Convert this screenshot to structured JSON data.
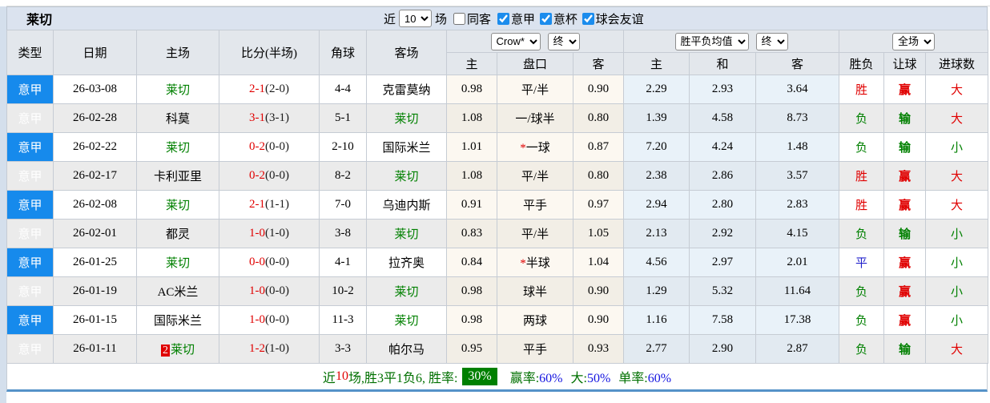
{
  "title": "莱切",
  "controls": {
    "recent_label": "近",
    "matches_value": "10",
    "matches_label": "场",
    "same_away": {
      "label": "同客",
      "checked": false
    },
    "filters": [
      {
        "label": "意甲",
        "checked": true
      },
      {
        "label": "意杯",
        "checked": true
      },
      {
        "label": "球会友谊",
        "checked": true
      }
    ]
  },
  "table": {
    "headers": {
      "type": "类型",
      "date": "日期",
      "home": "主场",
      "score": "比分(半场)",
      "corner": "角球",
      "away": "客场",
      "crow_dropdown": "Crow*",
      "crow_final_dropdown": "终",
      "avg_dropdown": "胜平负均值",
      "avg_final_dropdown": "终",
      "scope_dropdown": "全场",
      "odds_home": "主",
      "odds_handicap": "盘口",
      "odds_away": "客",
      "avg_home": "主",
      "avg_draw": "和",
      "avg_away": "客",
      "result": "胜负",
      "handicap_result": "让球",
      "goals": "进球数"
    },
    "rows": [
      {
        "league": "意甲",
        "date": "26-03-08",
        "home": "莱切",
        "home_focus": true,
        "home_badge": "",
        "score_ft": "2-1",
        "score_ht": "(2-0)",
        "corners": "4-4",
        "away": "克雷莫纳",
        "away_focus": false,
        "crow_home": "0.98",
        "handicap_star": false,
        "handicap": "平/半",
        "crow_away": "0.90",
        "avg_home": "2.29",
        "avg_draw": "2.93",
        "avg_away": "3.64",
        "result": "胜",
        "handicap_result": "赢",
        "goals": "大"
      },
      {
        "league": "意甲",
        "date": "26-02-28",
        "home": "科莫",
        "home_focus": false,
        "home_badge": "",
        "score_ft": "3-1",
        "score_ht": "(3-1)",
        "corners": "5-1",
        "away": "莱切",
        "away_focus": true,
        "crow_home": "1.08",
        "handicap_star": false,
        "handicap": "一/球半",
        "crow_away": "0.80",
        "avg_home": "1.39",
        "avg_draw": "4.58",
        "avg_away": "8.73",
        "result": "负",
        "handicap_result": "输",
        "goals": "大"
      },
      {
        "league": "意甲",
        "date": "26-02-22",
        "home": "莱切",
        "home_focus": true,
        "home_badge": "",
        "score_ft": "0-2",
        "score_ht": "(0-0)",
        "corners": "2-10",
        "away": "国际米兰",
        "away_focus": false,
        "crow_home": "1.01",
        "handicap_star": true,
        "handicap": "一球",
        "crow_away": "0.87",
        "avg_home": "7.20",
        "avg_draw": "4.24",
        "avg_away": "1.48",
        "result": "负",
        "handicap_result": "输",
        "goals": "小"
      },
      {
        "league": "意甲",
        "date": "26-02-17",
        "home": "卡利亚里",
        "home_focus": false,
        "home_badge": "",
        "score_ft": "0-2",
        "score_ht": "(0-0)",
        "corners": "8-2",
        "away": "莱切",
        "away_focus": true,
        "crow_home": "1.08",
        "handicap_star": false,
        "handicap": "平/半",
        "crow_away": "0.80",
        "avg_home": "2.38",
        "avg_draw": "2.86",
        "avg_away": "3.57",
        "result": "胜",
        "handicap_result": "赢",
        "goals": "大"
      },
      {
        "league": "意甲",
        "date": "26-02-08",
        "home": "莱切",
        "home_focus": true,
        "home_badge": "",
        "score_ft": "2-1",
        "score_ht": "(1-1)",
        "corners": "7-0",
        "away": "乌迪内斯",
        "away_focus": false,
        "crow_home": "0.91",
        "handicap_star": false,
        "handicap": "平手",
        "crow_away": "0.97",
        "avg_home": "2.94",
        "avg_draw": "2.80",
        "avg_away": "2.83",
        "result": "胜",
        "handicap_result": "赢",
        "goals": "大"
      },
      {
        "league": "意甲",
        "date": "26-02-01",
        "home": "都灵",
        "home_focus": false,
        "home_badge": "",
        "score_ft": "1-0",
        "score_ht": "(1-0)",
        "corners": "3-8",
        "away": "莱切",
        "away_focus": true,
        "crow_home": "0.83",
        "handicap_star": false,
        "handicap": "平/半",
        "crow_away": "1.05",
        "avg_home": "2.13",
        "avg_draw": "2.92",
        "avg_away": "4.15",
        "result": "负",
        "handicap_result": "输",
        "goals": "小"
      },
      {
        "league": "意甲",
        "date": "26-01-25",
        "home": "莱切",
        "home_focus": true,
        "home_badge": "",
        "score_ft": "0-0",
        "score_ht": "(0-0)",
        "corners": "4-1",
        "away": "拉齐奥",
        "away_focus": false,
        "crow_home": "0.84",
        "handicap_star": true,
        "handicap": "半球",
        "crow_away": "1.04",
        "avg_home": "4.56",
        "avg_draw": "2.97",
        "avg_away": "2.01",
        "result": "平",
        "handicap_result": "赢",
        "goals": "小"
      },
      {
        "league": "意甲",
        "date": "26-01-19",
        "home": "AC米兰",
        "home_focus": false,
        "home_badge": "",
        "score_ft": "1-0",
        "score_ht": "(0-0)",
        "corners": "10-2",
        "away": "莱切",
        "away_focus": true,
        "crow_home": "0.98",
        "handicap_star": false,
        "handicap": "球半",
        "crow_away": "0.90",
        "avg_home": "1.29",
        "avg_draw": "5.32",
        "avg_away": "11.64",
        "result": "负",
        "handicap_result": "赢",
        "goals": "小"
      },
      {
        "league": "意甲",
        "date": "26-01-15",
        "home": "国际米兰",
        "home_focus": false,
        "home_badge": "",
        "score_ft": "1-0",
        "score_ht": "(0-0)",
        "corners": "11-3",
        "away": "莱切",
        "away_focus": true,
        "crow_home": "0.98",
        "handicap_star": false,
        "handicap": "两球",
        "crow_away": "0.90",
        "avg_home": "1.16",
        "avg_draw": "7.58",
        "avg_away": "17.38",
        "result": "负",
        "handicap_result": "赢",
        "goals": "小"
      },
      {
        "league": "意甲",
        "date": "26-01-11",
        "home": "莱切",
        "home_focus": true,
        "home_badge": "2",
        "score_ft": "1-2",
        "score_ht": "(1-0)",
        "corners": "3-3",
        "away": "帕尔马",
        "away_focus": false,
        "crow_home": "0.95",
        "handicap_star": false,
        "handicap": "平手",
        "crow_away": "0.93",
        "avg_home": "2.77",
        "avg_draw": "2.90",
        "avg_away": "2.87",
        "result": "负",
        "handicap_result": "输",
        "goals": "大"
      }
    ]
  },
  "footer": {
    "prefix": "近",
    "count": "10",
    "summary": "场,胜3平1负6, 胜率:",
    "win_rate": "30%",
    "stats": [
      {
        "label": "赢率:",
        "value": "60%"
      },
      {
        "label": "大:",
        "value": "50%"
      },
      {
        "label": "单率:",
        "value": "60%"
      }
    ]
  }
}
